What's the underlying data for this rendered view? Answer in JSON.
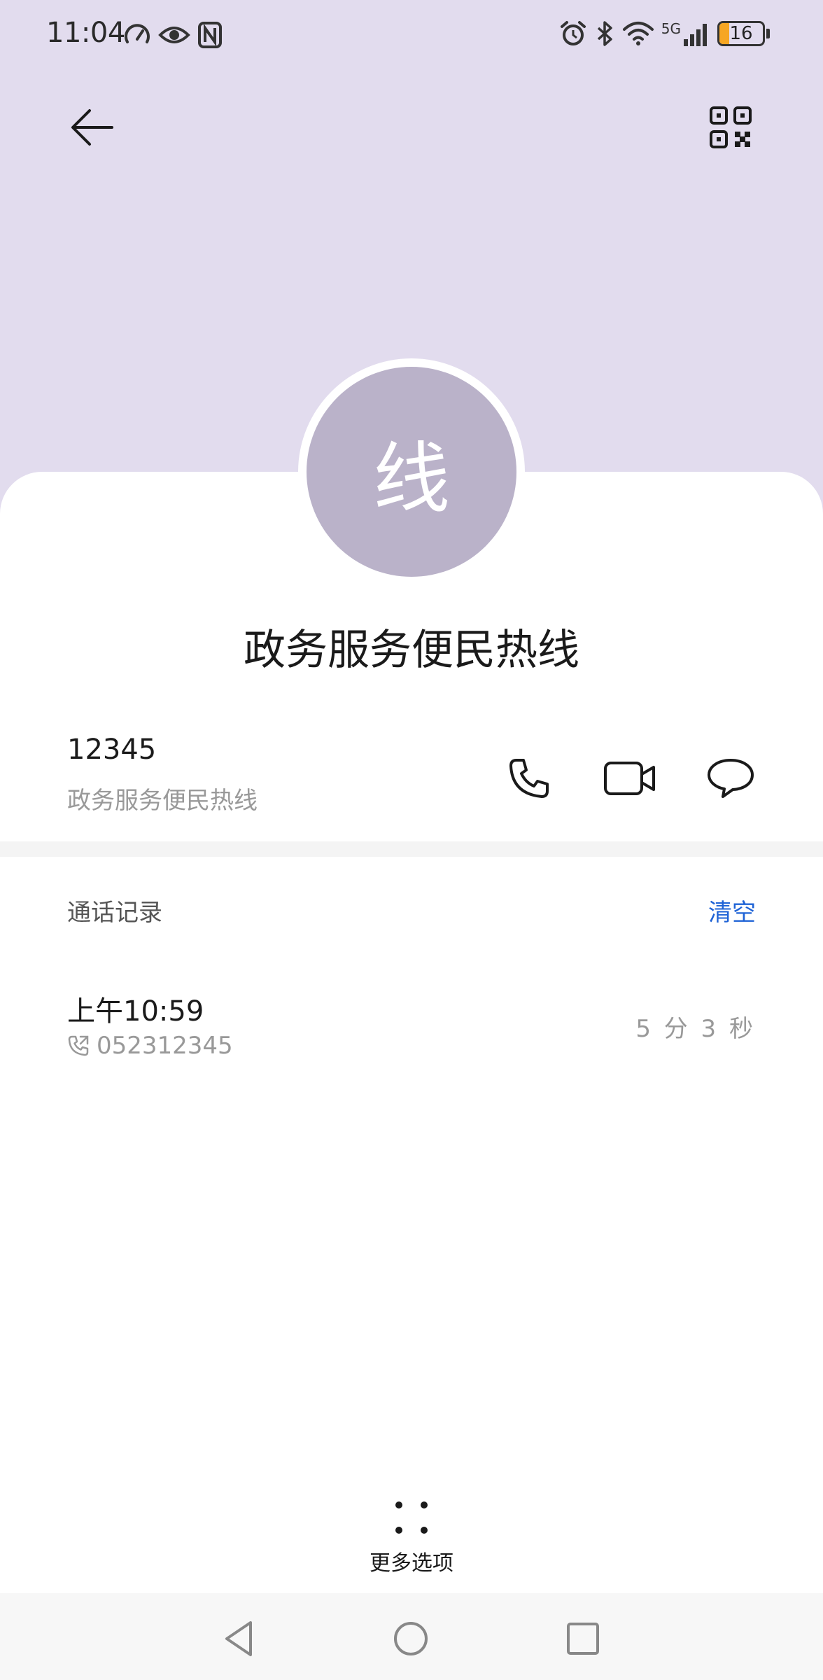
{
  "status_bar": {
    "time": "11:04",
    "battery_level": "16",
    "battery_fraction": 0.16,
    "network": "5G",
    "left_icons": [
      "speedometer-icon",
      "eye-icon",
      "nfc-icon"
    ],
    "right_icons": [
      "alarm-icon",
      "bluetooth-icon",
      "wifi-icon",
      "signal-icon",
      "battery-icon"
    ]
  },
  "toolbar": {
    "back_icon": "arrow-left-icon",
    "qr_icon": "qr-code-icon"
  },
  "contact": {
    "avatar_initial": "线",
    "name": "政务服务便民热线",
    "avatar_color": "#bab2c9",
    "header_color": "#e2dcee"
  },
  "number_row": {
    "number": "12345",
    "label": "政务服务便民热线",
    "actions": [
      "phone-icon",
      "video-call-icon",
      "message-icon"
    ]
  },
  "call_log": {
    "title": "通话记录",
    "clear_label": "清空",
    "accent_color": "#1f63d6",
    "entries": [
      {
        "time": "上午10:59",
        "number": "052312345",
        "duration": "5 分 3 秒",
        "type_icon": "outgoing-call-icon"
      }
    ]
  },
  "more": {
    "label": "更多选项",
    "icon": "more-dots-icon"
  },
  "nav_bar": {
    "icons": [
      "nav-back-icon",
      "nav-home-icon",
      "nav-recent-icon"
    ]
  }
}
